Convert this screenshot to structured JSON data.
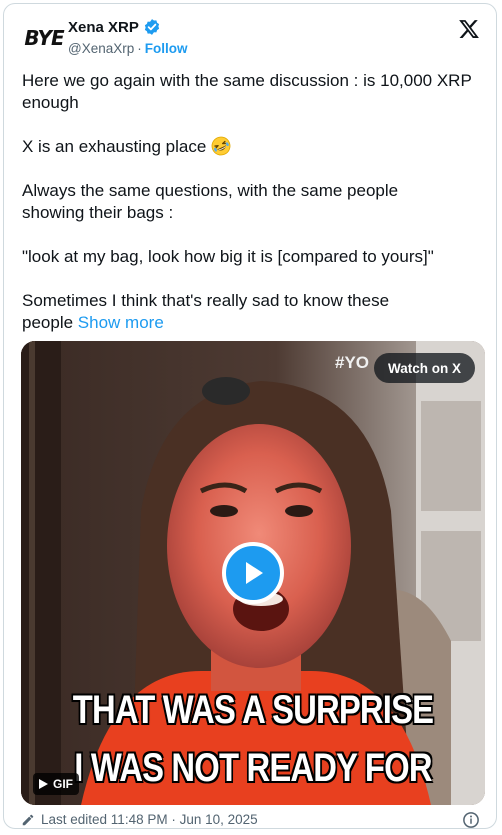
{
  "author": {
    "avatar_text": "BYE",
    "display_name": "Xena XRP",
    "handle": "@XenaXrp",
    "separator": "·",
    "follow_label": "Follow"
  },
  "tweet": {
    "paragraphs": [
      "Here we go again with the same discussion : is 10,000 XRP\nenough",
      "X is an exhausting place",
      "Always the same questions, with the same people\nshowing their bags :",
      "\"look at my bag, look how big it is [compared to yours]\"",
      "Sometimes I think that's really sad to know these\npeople"
    ],
    "show_more_label": "Show more",
    "emoji": "rolling-on-floor-laughing-emoji"
  },
  "media": {
    "hashtag_text": "#YO",
    "watch_label": "Watch on X",
    "caption_line1": "THAT WAS A SURPRISE",
    "caption_line2": "I WAS NOT READY FOR",
    "badge_label": "GIF"
  },
  "footer": {
    "edited_text": "Last edited 11:48 PM · Jun 10, 2025"
  },
  "colors": {
    "accent": "#1d9bf0",
    "text": "#0f1419",
    "muted": "#536471",
    "border": "#cfd9de"
  }
}
